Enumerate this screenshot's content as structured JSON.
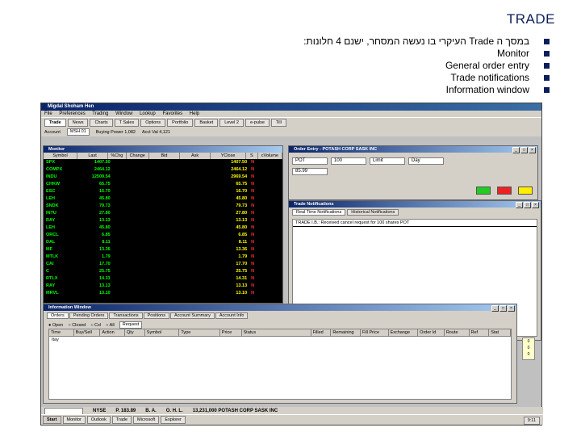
{
  "slide": {
    "title": "TRADE",
    "bullets": [
      "במסך ה Trade העיקרי בו נעשה המסחר, ישנם 4 חלונות:",
      "Monitor",
      "General order entry",
      "Trade notifications",
      "Information window"
    ]
  },
  "app": {
    "window_title": "Migdal Shoham Hen",
    "menu": [
      "File",
      "Preferences",
      "Trading",
      "Window",
      "Lookup",
      "Favorites",
      "Help"
    ],
    "tabs": [
      "Trade",
      "News",
      "Charts",
      "T Sales",
      "Options",
      "Portfolio",
      "Basket",
      "Level 2",
      "e-pulse",
      "Till"
    ],
    "account_label": "Account",
    "account_value": "MSH 01",
    "buying_power": "Buying Power 1,082",
    "acct_val": "Acct Val 4,121",
    "monitor": {
      "title": "Monitor",
      "columns": [
        "Symbol",
        "Last",
        "%Chg",
        "Change",
        "Bid",
        "Ask",
        "YClose",
        "S",
        "cVolume"
      ],
      "rows": [
        {
          "symbol": "SPX",
          "last": "1407.50",
          "yclose": "1407.50",
          "s": "N"
        },
        {
          "symbol": "COMPX",
          "last": "2464.12",
          "yclose": "2464.12",
          "s": "N"
        },
        {
          "symbol": "INDU",
          "last": "12509.54",
          "yclose": "2969.54",
          "s": "N"
        },
        {
          "symbol": "CHKW",
          "last": "65.75",
          "yclose": "65.75",
          "s": "N"
        },
        {
          "symbol": "ESC",
          "last": "16.70",
          "yclose": "16.70",
          "s": "N"
        },
        {
          "symbol": "LEH",
          "last": "45.80",
          "yclose": "45.80",
          "s": "N"
        },
        {
          "symbol": "SNDK",
          "last": "79.73",
          "yclose": "79.73",
          "s": "N"
        },
        {
          "symbol": "INTU",
          "last": "27.80",
          "yclose": "27.80",
          "s": "N"
        },
        {
          "symbol": "RAY",
          "last": "13.13",
          "yclose": "13.13",
          "s": "N"
        },
        {
          "symbol": "LEH",
          "last": "45.80",
          "yclose": "45.80",
          "s": "N"
        },
        {
          "symbol": "ORCL",
          "last": "6.85",
          "yclose": "6.85",
          "s": "N"
        },
        {
          "symbol": "DAL",
          "last": "8.11",
          "yclose": "8.11",
          "s": "N"
        },
        {
          "symbol": "MF",
          "last": "13.36",
          "yclose": "13.36",
          "s": "N"
        },
        {
          "symbol": "MTLK",
          "last": "1.79",
          "yclose": "1.79",
          "s": "N"
        },
        {
          "symbol": "CAI",
          "last": "17.70",
          "yclose": "17.70",
          "s": "N"
        },
        {
          "symbol": "C",
          "last": "25.75",
          "yclose": "25.75",
          "s": "N"
        },
        {
          "symbol": "RTLX",
          "last": "14.31",
          "yclose": "14.31",
          "s": "N"
        },
        {
          "symbol": "RAY",
          "last": "13.13",
          "yclose": "13.13",
          "s": "N"
        },
        {
          "symbol": "MRVL",
          "last": "13.10",
          "yclose": "13.10",
          "s": "N"
        }
      ]
    },
    "order_entry": {
      "title": "Order Entry - POTASH CORP SASK INC",
      "symbol": "POT",
      "quantity": "100",
      "price": "85.99",
      "type": "Limit",
      "tif": "Day"
    },
    "notifications": {
      "title": "Trade Notifications",
      "tabs": [
        "Real Time Notifications",
        "Historical Notifications"
      ],
      "line": "TRADE I.B.: Received cancel request for 100 shares POT"
    },
    "info": {
      "title": "Information Window",
      "tabs": [
        "Orders",
        "Pending Orders",
        "Transactions",
        "Positions",
        "Account Summary",
        "Account Info"
      ],
      "filters": [
        "Open",
        "Closed",
        "Cxl",
        "All"
      ],
      "request_label": "Request",
      "columns": [
        "Time",
        "Buy/Sell",
        "Action",
        "Qty",
        "Symbol",
        "Type",
        "Price",
        "Status",
        "Filled",
        "Remaining",
        "Fill Price",
        "Exchange",
        "Order Id",
        "Route",
        "Ref",
        "Stat"
      ],
      "first_row": "Itay"
    },
    "side_values": [
      "0",
      "0",
      "0"
    ],
    "status": {
      "exchange": "NYSE",
      "price": "P. 183.89",
      "bid": "B. A.",
      "high": "O. H. L.",
      "summary": "13,231,000 POTASH CORP SASK INC"
    },
    "taskbar": [
      "Start",
      "Monitor",
      "Outlook",
      "Trade",
      "Microsoft",
      "Explorer"
    ],
    "clock": "9:11"
  },
  "colors": {
    "title_navy": "#0b1e5a",
    "bullet_square": "#0b1e5a",
    "monitor_bg": "#000000",
    "monitor_text_green": "#00ff00",
    "monitor_yclose_yellow": "#ffff00",
    "monitor_flag_red": "#ff3030"
  }
}
